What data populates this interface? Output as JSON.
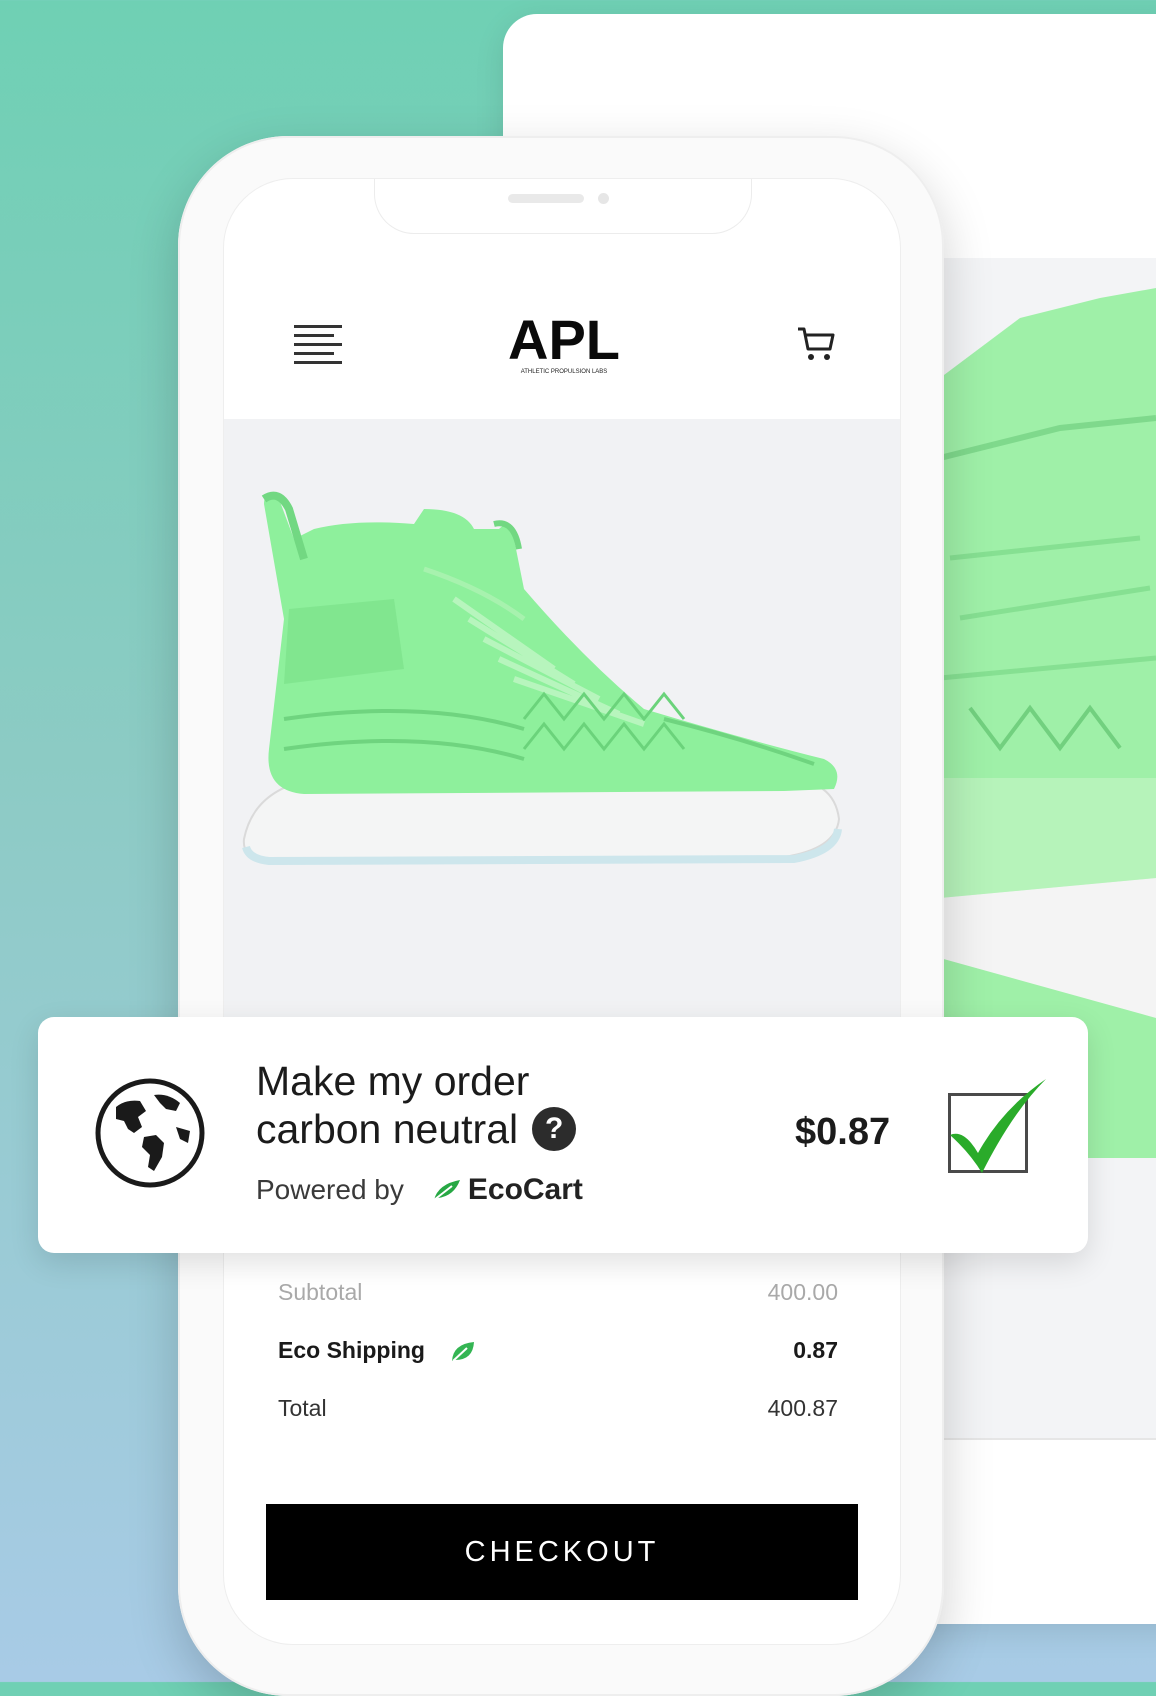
{
  "brand": {
    "logo_text": "APL",
    "logo_tagline": "ATHLETIC PROPULSION LABS"
  },
  "carbon_offer": {
    "title_line1": "Make my order",
    "title_line2": "carbon neutral",
    "help_symbol": "?",
    "powered_by": "Powered by",
    "provider": "EcoCart",
    "price": "$0.87",
    "checked": true
  },
  "summary": {
    "subtotal_label": "Subtotal",
    "subtotal_value": "400.00",
    "shipping_label": "Eco Shipping",
    "shipping_value": "0.87",
    "total_label": "Total",
    "total_value": "400.87"
  },
  "checkout": {
    "label": "CHECKOUT"
  },
  "icons": {
    "menu": "menu-icon",
    "cart": "cart-icon",
    "globe": "globe-icon",
    "help": "help-icon",
    "leaf": "leaf-icon",
    "checkmark": "checkmark-icon"
  },
  "colors": {
    "bg_top": "#6fd0b4",
    "bg_bottom": "#a8cbe6",
    "shoe_green": "#8eef9c",
    "eco_green": "#27a844",
    "button_black": "#000000"
  }
}
